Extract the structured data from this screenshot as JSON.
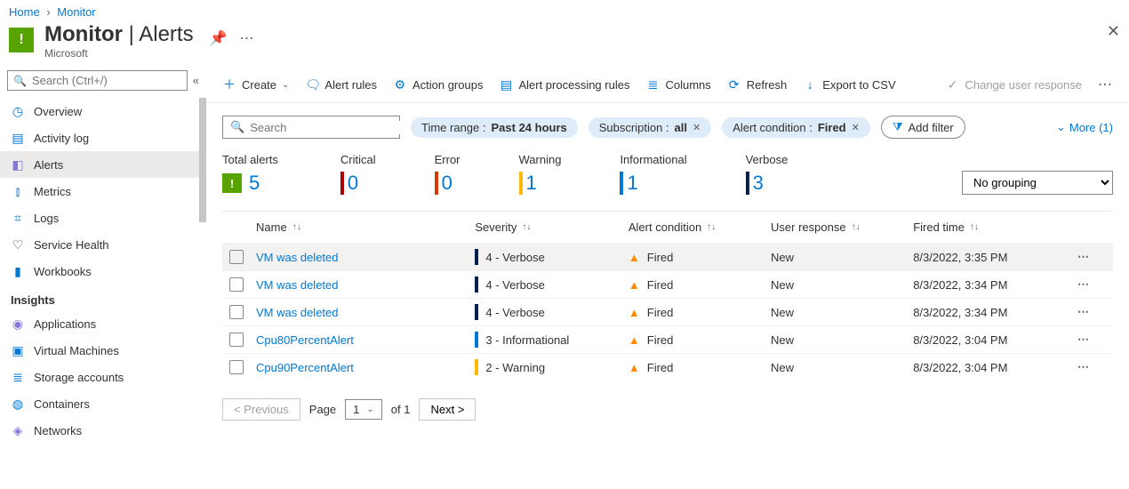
{
  "breadcrumb": {
    "home": "Home",
    "monitor": "Monitor"
  },
  "header": {
    "title": "Monitor",
    "section": "Alerts",
    "subtitle": "Microsoft"
  },
  "sidebar": {
    "search_placeholder": "Search (Ctrl+/)",
    "items": [
      {
        "label": "Overview",
        "icon": "◷",
        "cls": "c-bl"
      },
      {
        "label": "Activity log",
        "icon": "▤",
        "cls": "c-bl"
      },
      {
        "label": "Alerts",
        "icon": "◧",
        "cls": "c-pu",
        "selected": true
      },
      {
        "label": "Metrics",
        "icon": "⫾",
        "cls": "c-bl"
      },
      {
        "label": "Logs",
        "icon": "⌗",
        "cls": "c-bl"
      },
      {
        "label": "Service Health",
        "icon": "♡",
        "cls": ""
      },
      {
        "label": "Workbooks",
        "icon": "▮",
        "cls": "c-bl"
      }
    ],
    "insights_header": "Insights",
    "insights": [
      {
        "label": "Applications",
        "icon": "◉",
        "cls": "c-pu"
      },
      {
        "label": "Virtual Machines",
        "icon": "▣",
        "cls": "c-bl"
      },
      {
        "label": "Storage accounts",
        "icon": "≣",
        "cls": "c-bl"
      },
      {
        "label": "Containers",
        "icon": "◍",
        "cls": "c-bl"
      },
      {
        "label": "Networks",
        "icon": "◈",
        "cls": "c-pu"
      }
    ]
  },
  "toolbar": {
    "create": "Create",
    "alert_rules": "Alert rules",
    "action_groups": "Action groups",
    "processing": "Alert processing rules",
    "columns": "Columns",
    "refresh": "Refresh",
    "export": "Export to CSV",
    "change_resp": "Change user response"
  },
  "filters": {
    "search_placeholder": "Search",
    "time_label": "Time range :",
    "time_value": "Past 24 hours",
    "sub_label": "Subscription :",
    "sub_value": "all",
    "cond_label": "Alert condition :",
    "cond_value": "Fired",
    "add": "Add filter",
    "more": "More (1)"
  },
  "summary": {
    "total": {
      "label": "Total alerts",
      "value": "5"
    },
    "levels": [
      {
        "label": "Critical",
        "value": "0",
        "color": "#a80000"
      },
      {
        "label": "Error",
        "value": "0",
        "color": "#d83b01"
      },
      {
        "label": "Warning",
        "value": "1",
        "color": "#ffb900"
      },
      {
        "label": "Informational",
        "value": "1",
        "color": "#0078d4"
      },
      {
        "label": "Verbose",
        "value": "3",
        "color": "#002050"
      }
    ],
    "grouping_selected": "No grouping"
  },
  "table": {
    "headers": {
      "name": "Name",
      "severity": "Severity",
      "condition": "Alert condition",
      "response": "User response",
      "fired": "Fired time"
    },
    "rows": [
      {
        "name": "VM was deleted",
        "severity": "4 - Verbose",
        "sevcolor": "#002050",
        "condition": "Fired",
        "response": "New",
        "fired": "8/3/2022, 3:35 PM",
        "hover": true
      },
      {
        "name": "VM was deleted",
        "severity": "4 - Verbose",
        "sevcolor": "#002050",
        "condition": "Fired",
        "response": "New",
        "fired": "8/3/2022, 3:34 PM"
      },
      {
        "name": "VM was deleted",
        "severity": "4 - Verbose",
        "sevcolor": "#002050",
        "condition": "Fired",
        "response": "New",
        "fired": "8/3/2022, 3:34 PM"
      },
      {
        "name": "Cpu80PercentAlert",
        "severity": "3 - Informational",
        "sevcolor": "#0078d4",
        "condition": "Fired",
        "response": "New",
        "fired": "8/3/2022, 3:04 PM"
      },
      {
        "name": "Cpu90PercentAlert",
        "severity": "2 - Warning",
        "sevcolor": "#ffb900",
        "condition": "Fired",
        "response": "New",
        "fired": "8/3/2022, 3:04 PM"
      }
    ]
  },
  "pager": {
    "prev": "< Previous",
    "page_label": "Page",
    "page": "1",
    "of": "of 1",
    "next": "Next >"
  }
}
